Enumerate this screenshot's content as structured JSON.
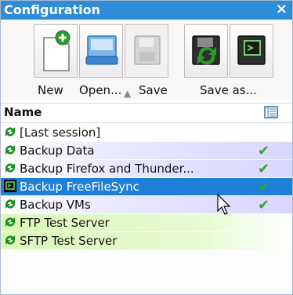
{
  "window": {
    "title": "Configuration",
    "close_glyph": "×"
  },
  "toolbar": {
    "new_label": "New",
    "open_label": "Open...",
    "save_label": "Save",
    "save_as_label": "Save as..."
  },
  "list_header": {
    "name_label": "Name",
    "column_icon": "column-settings-icon"
  },
  "rows": [
    {
      "label": "[Last session]",
      "check": false,
      "bg": "#ffffff"
    },
    {
      "label": "Backup Data",
      "check": true,
      "bg": "#e3e1ff"
    },
    {
      "label": "Backup Firefox and Thunder...",
      "check": true,
      "bg": "#e3e1ff"
    },
    {
      "label": "Backup FreeFileSync",
      "check": true,
      "bg": "#1e7fd6",
      "selected": true
    },
    {
      "label": "Backup VMs",
      "check": true,
      "bg": "#e3e1ff"
    },
    {
      "label": "FTP Test Server",
      "check": false,
      "bg": "#d7f7b8"
    },
    {
      "label": "SFTP Test Server",
      "check": false,
      "bg": "#d7f7b8"
    }
  ],
  "colors": {
    "title_bg": "#2f8cd9",
    "selection": "#1e7fd6",
    "check": "#3aa23a",
    "sync_icon": "#1b8f2a"
  }
}
